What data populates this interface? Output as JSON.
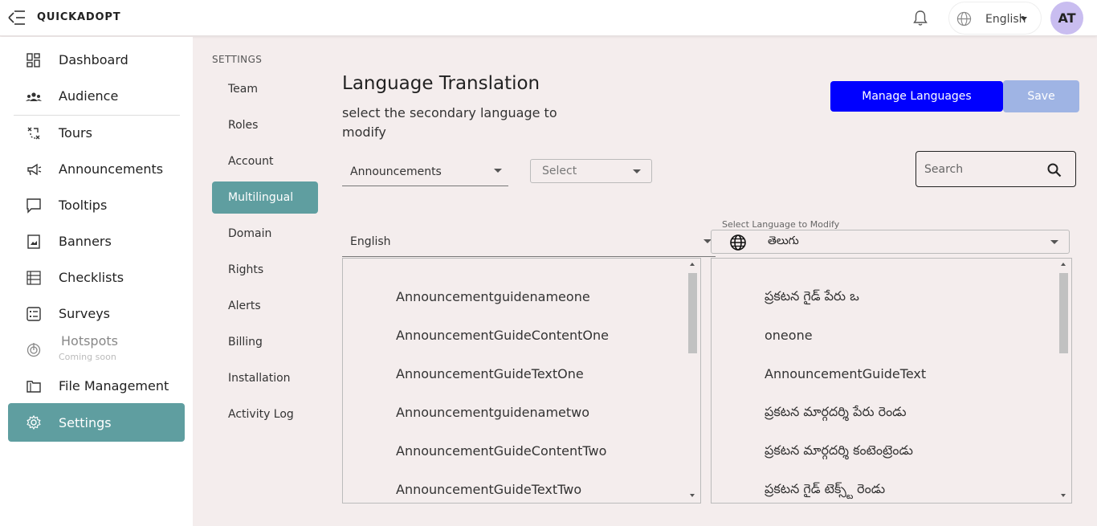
{
  "header": {
    "brand": "QUICKADOPT",
    "language": "English",
    "avatar_initials": "AT"
  },
  "sidebar": {
    "items": [
      {
        "label": "Dashboard",
        "icon": "dashboard-icon"
      },
      {
        "label": "Audience",
        "icon": "audience-icon"
      },
      {
        "label": "Tours",
        "icon": "tours-icon"
      },
      {
        "label": "Announcements",
        "icon": "megaphone-icon"
      },
      {
        "label": "Tooltips",
        "icon": "tooltip-icon"
      },
      {
        "label": "Banners",
        "icon": "banner-icon"
      },
      {
        "label": "Checklists",
        "icon": "checklist-icon"
      },
      {
        "label": "Surveys",
        "icon": "survey-icon"
      },
      {
        "label": "Hotspots",
        "icon": "hotspot-icon",
        "sub": "Coming soon"
      },
      {
        "label": "File Management",
        "icon": "folder-icon"
      },
      {
        "label": "Settings",
        "icon": "gear-icon"
      }
    ],
    "active": "Settings"
  },
  "settings_menu": {
    "title": "SETTINGS",
    "items": [
      "Team",
      "Roles",
      "Account",
      "Multilingual",
      "Domain",
      "Rights",
      "Alerts",
      "Billing",
      "Installation",
      "Activity Log"
    ],
    "active": "Multilingual"
  },
  "main": {
    "title": "Language Translation",
    "description": "select the secondary language to modify",
    "manage_button": "Manage Languages",
    "save_button": "Save",
    "guide_type": "Announcements",
    "guide_select": "Select",
    "search_placeholder": "Search",
    "source_language": "English",
    "target_legend": "Select Language to Modify",
    "target_language": "తెలుగు"
  },
  "source_rows": [
    "Announcementguidenameone",
    "AnnouncementGuideContentOne",
    "AnnouncementGuideTextOne",
    "Announcementguidenametwo",
    "AnnouncementGuideContentTwo",
    "AnnouncementGuideTextTwo"
  ],
  "target_rows": [
    "ప్రకటన గైడ్ పేరు ఒ",
    "oneone",
    "AnnouncementGuideText",
    "ప్రకటన మార్గదర్శి పేరు రెండు",
    "ప్రకటన మార్గదర్శి కంటెంట్రెండు",
    "ప్రకటన గైడ్ టెక్స్ట్ రెండు"
  ],
  "colors": {
    "accent": "#5f9ea0",
    "primary_button": "#0000ff",
    "save_disabled": "#9fb4e4",
    "avatar": "#c9bdf0",
    "background": "#f4eded"
  }
}
